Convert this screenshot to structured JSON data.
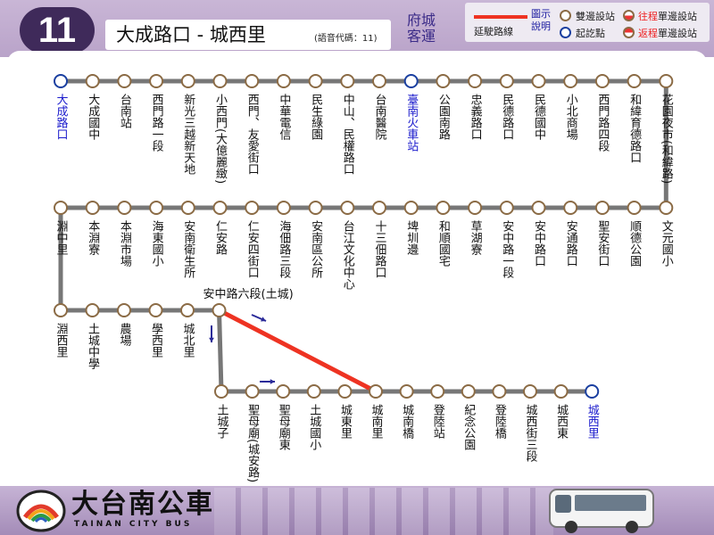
{
  "header": {
    "route_number": "11",
    "route_name": "大成路口 - 城西里",
    "voice_code": "(語音代碼：11)",
    "operator": "府城客運"
  },
  "legend": {
    "title": "圖示說明",
    "red_line_label": "延駛路線",
    "both_direction_label": "雙邊設站",
    "terminal_label": "起訖點",
    "outbound_prefix": "往程",
    "inbound_prefix": "返程",
    "one_side_suffix": "單邊設站"
  },
  "colors": {
    "route_line": "#777777",
    "extension_line": "#ee3322",
    "stop_border": "#8b6b45",
    "terminal_border": "#1a3fa0",
    "terminal_text": "#1a1acc",
    "direction_arrow": "#2a2a99"
  },
  "stops_row1": [
    {
      "name": "大成路口",
      "terminal": true
    },
    {
      "name": "大成國中"
    },
    {
      "name": "台南站"
    },
    {
      "name": "西門路一段"
    },
    {
      "name": "新光三越新天地"
    },
    {
      "name": "小西門(大億麗緻)"
    },
    {
      "name": "西門、友愛街口"
    },
    {
      "name": "中華電信"
    },
    {
      "name": "民生綠園"
    },
    {
      "name": "中山、民權路口"
    },
    {
      "name": "台南醫院"
    },
    {
      "name": "臺南火車站",
      "terminal": true
    },
    {
      "name": "公園南路"
    },
    {
      "name": "忠義路口"
    },
    {
      "name": "民德路口"
    },
    {
      "name": "民德國中"
    },
    {
      "name": "小北商場"
    },
    {
      "name": "西門路四段"
    },
    {
      "name": "和緯育德路口"
    },
    {
      "name": "花園夜市(和緯路)"
    }
  ],
  "stops_row2": [
    {
      "name": "淵中里"
    },
    {
      "name": "本淵寮"
    },
    {
      "name": "本淵市場"
    },
    {
      "name": "海東國小"
    },
    {
      "name": "安南衛生所"
    },
    {
      "name": "仁安路"
    },
    {
      "name": "仁安四街口"
    },
    {
      "name": "海佃路三段"
    },
    {
      "name": "安南區公所"
    },
    {
      "name": "台江文化中心"
    },
    {
      "name": "十三佃路口"
    },
    {
      "name": "埤圳邊"
    },
    {
      "name": "和順國宅"
    },
    {
      "name": "草湖寮"
    },
    {
      "name": "安中路一段"
    },
    {
      "name": "安中路口"
    },
    {
      "name": "安通路口"
    },
    {
      "name": "聖安街口"
    },
    {
      "name": "順德公園"
    },
    {
      "name": "文元國小"
    }
  ],
  "stops_row3": [
    {
      "name": "淵西里"
    },
    {
      "name": "土城中學"
    },
    {
      "name": "農場"
    },
    {
      "name": "學西里"
    },
    {
      "name": "城北里"
    },
    {
      "name": "安中路六段(土城)"
    }
  ],
  "stops_row4": [
    {
      "name": "土城子"
    },
    {
      "name": "聖母廟(城安路)"
    },
    {
      "name": "聖母廟東"
    },
    {
      "name": "土城國小"
    },
    {
      "name": "城東里"
    },
    {
      "name": "城南里"
    },
    {
      "name": "城南橋"
    },
    {
      "name": "登陸站"
    },
    {
      "name": "紀念公園"
    },
    {
      "name": "登陸橋"
    },
    {
      "name": "城西街三段"
    },
    {
      "name": "城西東"
    },
    {
      "name": "城西里",
      "terminal": true
    }
  ],
  "footer": {
    "brand": "大台南公車",
    "brand_en": "TAINAN CITY BUS"
  }
}
